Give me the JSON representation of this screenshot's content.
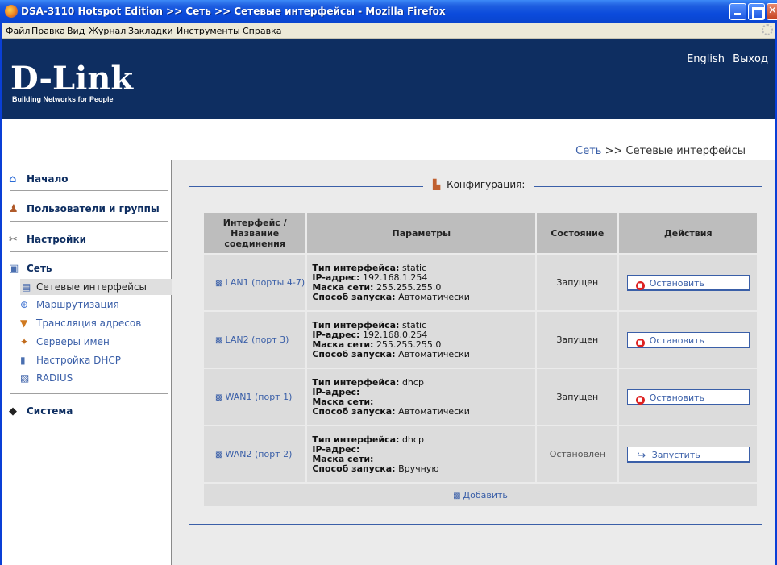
{
  "window": {
    "title": "DSA-3110 Hotspot Edition >> Сеть >> Сетевые интерфейсы - Mozilla Firefox"
  },
  "menu": [
    "Файл",
    "Правка",
    "Вид",
    "Журнал",
    "Закладки",
    "Инструменты",
    "Справка"
  ],
  "header": {
    "logo": "D-Link",
    "tagline": "Building Networks for People",
    "lang_link": "English",
    "logout_link": "Выход"
  },
  "breadcrumb": {
    "section": "Сеть",
    "separator": ">>",
    "page": "Сетевые интерфейсы"
  },
  "sidebar": {
    "home": "Начало",
    "users": "Пользователи и группы",
    "settings": "Настройки",
    "network": "Сеть",
    "network_items": [
      "Сетевые интерфейсы",
      "Маршрутизация",
      "Трансляция адресов",
      "Серверы имен",
      "Настройка DHCP",
      "RADIUS"
    ],
    "system": "Система"
  },
  "config": {
    "legend": "Конфигурация:",
    "columns": {
      "interface": "Интерфейс / Название соединения",
      "params": "Параметры",
      "state": "Состояние",
      "actions": "Действия"
    },
    "param_labels": {
      "type": "Тип интерфейса:",
      "ip": "IP-адрес:",
      "mask": "Маска сети:",
      "start": "Способ запуска:"
    },
    "rows": [
      {
        "name": "LAN1 (порты 4-7)",
        "type": "static",
        "ip": "192.168.1.254",
        "mask": "255.255.255.0",
        "start": "Автоматически",
        "state": "Запущен",
        "action": "Остановить"
      },
      {
        "name": "LAN2 (порт 3)",
        "type": "static",
        "ip": "192.168.0.254",
        "mask": "255.255.255.0",
        "start": "Автоматически",
        "state": "Запущен",
        "action": "Остановить"
      },
      {
        "name": "WAN1 (порт 1)",
        "type": "dhcp",
        "ip": "",
        "mask": "",
        "start": "Автоматически",
        "state": "Запущен",
        "action": "Остановить"
      },
      {
        "name": "WAN2 (порт 2)",
        "type": "dhcp",
        "ip": "",
        "mask": "",
        "start": "Вручную",
        "state": "Остановлен",
        "action": "Запустить"
      }
    ],
    "add": "Добавить"
  },
  "colors": {
    "header_bg": "#0e2e61",
    "link": "#3a5fa8",
    "panel_bg": "#ebebeb",
    "titlebar": "#0b4bdc"
  }
}
